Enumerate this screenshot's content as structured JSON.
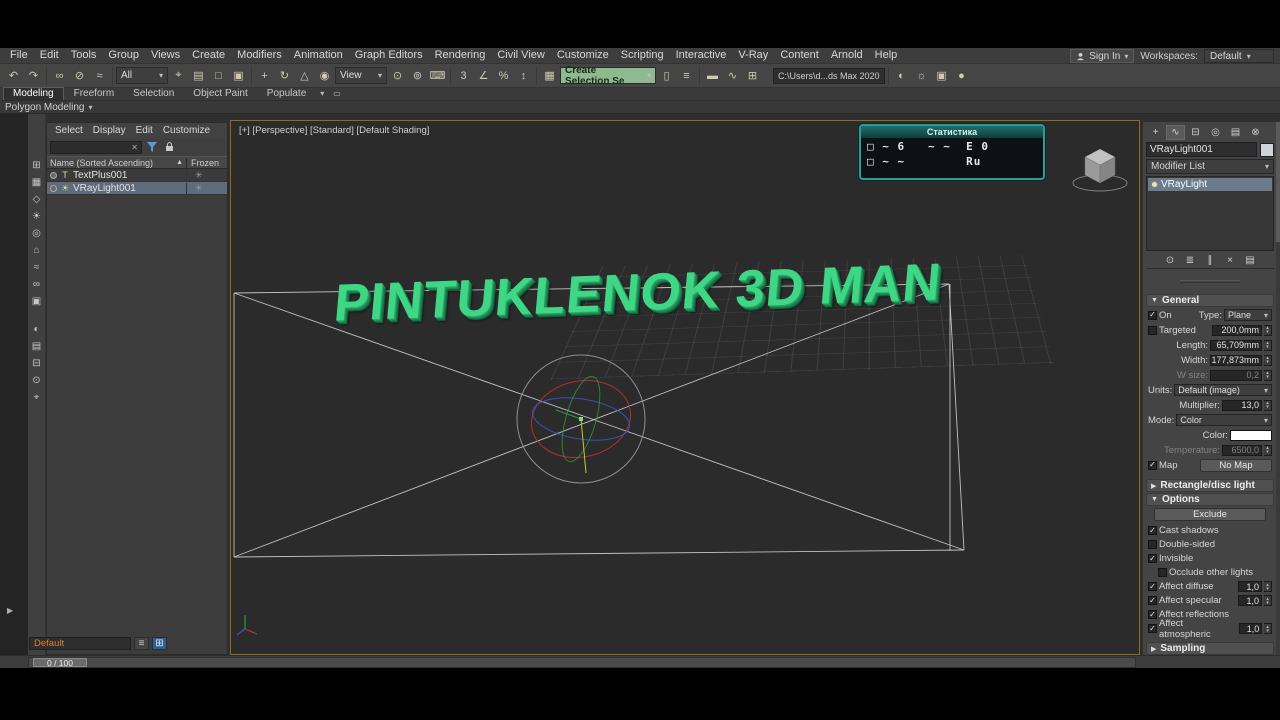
{
  "menu": {
    "items": [
      "File",
      "Edit",
      "Tools",
      "Group",
      "Views",
      "Create",
      "Modifiers",
      "Animation",
      "Graph Editors",
      "Rendering",
      "Civil View",
      "Customize",
      "Scripting",
      "Interactive",
      "V-Ray",
      "Content",
      "Arnold",
      "Help"
    ]
  },
  "account": {
    "sign_in": "Sign In",
    "workspaces_label": "Workspaces:",
    "workspaces_value": "Default"
  },
  "toolbar": {
    "filter_value": "All",
    "coord_value": "View",
    "selection_set_value": "Create Selection Se",
    "path_value": "C:\\Users\\d...ds Max 2020",
    "icons": [
      {
        "name": "undo-icon",
        "glyph": "↶"
      },
      {
        "name": "redo-icon",
        "glyph": "↷"
      },
      {
        "name": "select-and-link-icon",
        "glyph": "∞"
      },
      {
        "name": "unlink-selection-icon",
        "glyph": "⊘"
      },
      {
        "name": "bind-to-space-warp-icon",
        "glyph": "≈"
      },
      {
        "name": "select-object-icon",
        "glyph": "⌖"
      },
      {
        "name": "select-by-name-icon",
        "glyph": "▤"
      },
      {
        "name": "rectangular-selection-region-icon",
        "glyph": "□"
      },
      {
        "name": "window-crossing-icon",
        "glyph": "▣"
      },
      {
        "name": "select-and-move-icon",
        "glyph": "+"
      },
      {
        "name": "select-and-rotate-icon",
        "glyph": "↻"
      },
      {
        "name": "select-and-scale-icon",
        "glyph": "△"
      },
      {
        "name": "select-and-place-icon",
        "glyph": "◉"
      },
      {
        "name": "use-pivot-point-icon",
        "glyph": "⊙"
      },
      {
        "name": "select-and-manipulate-icon",
        "glyph": "⊚"
      },
      {
        "name": "keyboard-shortcut-override-icon",
        "glyph": "⌨"
      },
      {
        "name": "snap-toggle-3d-icon",
        "glyph": "3"
      },
      {
        "name": "angle-snap-icon",
        "glyph": "∠"
      },
      {
        "name": "percent-snap-icon",
        "glyph": "%"
      },
      {
        "name": "spinner-snap-icon",
        "glyph": "↕"
      },
      {
        "name": "edit-named-selection-sets-icon",
        "glyph": "▦"
      },
      {
        "name": "mirror-icon",
        "glyph": "▯"
      },
      {
        "name": "align-icon",
        "glyph": "≡"
      },
      {
        "name": "toggle-ribbon-icon",
        "glyph": "▬"
      },
      {
        "name": "curve-editor-icon",
        "glyph": "∿"
      },
      {
        "name": "schematic-view-icon",
        "glyph": "⊞"
      },
      {
        "name": "material-editor-icon",
        "glyph": "◐"
      },
      {
        "name": "render-setup-icon",
        "glyph": "☼"
      },
      {
        "name": "rendered-frame-window-icon",
        "glyph": "▣"
      },
      {
        "name": "render-production-icon",
        "glyph": "●"
      }
    ]
  },
  "ribbon": {
    "tabs": [
      "Modeling",
      "Freeform",
      "Selection",
      "Object Paint",
      "Populate"
    ],
    "sub_label": "Polygon Modeling"
  },
  "explorer": {
    "menus": [
      "Select",
      "Display",
      "Edit",
      "Customize"
    ],
    "header_name": "Name (Sorted Ascending)",
    "header_frozen": "Frozen",
    "rows": [
      {
        "name": "TextPlus001",
        "type_glyph": "T"
      },
      {
        "name": "VRayLight001",
        "type_glyph": "☀"
      }
    ],
    "explorer_name": "Default",
    "tool_icons": [
      {
        "name": "display-influences-icon",
        "glyph": "⊞"
      },
      {
        "name": "display-geometry-icon",
        "glyph": "▦"
      },
      {
        "name": "display-shapes-icon",
        "glyph": "◇"
      },
      {
        "name": "display-lights-icon",
        "glyph": "☀"
      },
      {
        "name": "display-cameras-icon",
        "glyph": "◎"
      },
      {
        "name": "display-helpers-icon",
        "glyph": "⌂"
      },
      {
        "name": "display-space-warps-icon",
        "glyph": "≈"
      },
      {
        "name": "display-bones-icon",
        "glyph": "∞"
      },
      {
        "name": "display-containers-icon",
        "glyph": "▣"
      },
      {
        "name": "display-materials-icon",
        "glyph": "◐"
      },
      {
        "name": "sort-by-layer-icon",
        "glyph": "▤"
      },
      {
        "name": "sort-by-hierarchy-icon",
        "glyph": "⊟"
      },
      {
        "name": "lock-cell-editing-icon",
        "glyph": "⊙"
      },
      {
        "name": "pick-parent-icon",
        "glyph": "⌖"
      }
    ]
  },
  "viewport": {
    "label": "[+] [Perspective] [Standard] [Default Shading]",
    "text3d": "PINTUKLENOK 3D MAN",
    "stats_title": "Статистика",
    "stats_row1": "□ ~ 6   ~ ~  E 0",
    "stats_row2": "□ ~ ~        Ru"
  },
  "panel": {
    "tabs": [
      {
        "name": "create-tab-icon",
        "glyph": "+"
      },
      {
        "name": "modify-tab-icon",
        "glyph": "∿"
      },
      {
        "name": "hierarchy-tab-icon",
        "glyph": "⊟"
      },
      {
        "name": "motion-tab-icon",
        "glyph": "◎"
      },
      {
        "name": "display-tab-icon",
        "glyph": "▤"
      },
      {
        "name": "utilities-tab-icon",
        "glyph": "⊗"
      }
    ],
    "object_name": "VRayLight001",
    "modifier_list_label": "Modifier List",
    "stack_item": "VRayLight",
    "stack_tools": [
      {
        "name": "pin-stack-icon",
        "glyph": "⊙"
      },
      {
        "name": "show-end-result-icon",
        "glyph": "≣"
      },
      {
        "name": "make-unique-icon",
        "glyph": "∥"
      },
      {
        "name": "remove-modifier-icon",
        "glyph": "×"
      },
      {
        "name": "configure-modifier-sets-icon",
        "glyph": "▤"
      }
    ],
    "general": {
      "title": "General",
      "on_label": "On",
      "type_label": "Type:",
      "type_value": "Plane",
      "targeted_label": "Targeted",
      "targeted_value": "200,0mm",
      "length_label": "Length:",
      "length_value": "65,709mm",
      "width_label": "Width:",
      "width_value": "177,873mm",
      "wsize_label": "W size:",
      "wsize_value": "0,2",
      "units_label": "Units:",
      "units_value": "Default (image)",
      "multiplier_label": "Multiplier:",
      "multiplier_value": "13,0",
      "mode_label": "Mode:",
      "mode_value": "Color",
      "color_label": "Color:",
      "temperature_label": "Temperature:",
      "temperature_value": "6500,0",
      "map_label": "Map",
      "map_button": "No Map"
    },
    "rect_title": "Rectangle/disc light",
    "options": {
      "title": "Options",
      "exclude_button": "Exclude",
      "rows": [
        {
          "label": "Cast shadows",
          "checked": true
        },
        {
          "label": "Double-sided",
          "checked": false
        },
        {
          "label": "Invisible",
          "checked": true
        },
        {
          "label": "Occlude other lights",
          "checked": false
        },
        {
          "label": "Affect diffuse",
          "checked": true,
          "value": "1,0"
        },
        {
          "label": "Affect specular",
          "checked": true,
          "value": "1,0"
        },
        {
          "label": "Affect reflections",
          "checked": true
        },
        {
          "label": "Affect atmospheric",
          "checked": true,
          "value": "1,0"
        }
      ]
    },
    "sampling_title": "Sampling"
  },
  "timeline": {
    "thumb": "0 / 100"
  },
  "colors": {
    "viewport_border": "#8f6b1f",
    "text3d_green": "#3fd686",
    "selection_row": "#5d6b7a",
    "stats_teal": "#2e9a92",
    "default_label_orange": "#e07b39"
  }
}
